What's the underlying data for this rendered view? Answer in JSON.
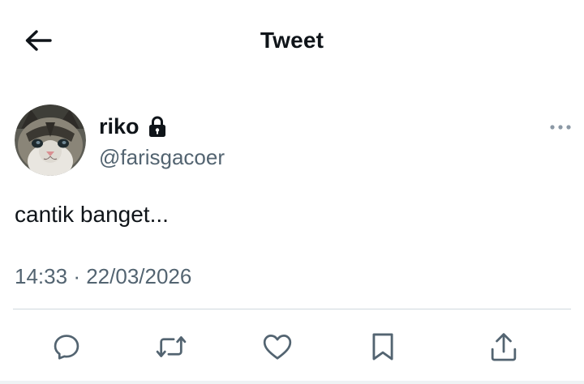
{
  "header": {
    "title": "Tweet",
    "back_icon": "arrow-left-icon"
  },
  "tweet": {
    "author": {
      "display_name": "riko",
      "handle": "@farisgacoer",
      "protected_icon": "lock-icon",
      "avatar": "cat-avatar"
    },
    "text": "cantik banget...",
    "time": "14:33",
    "separator": "·",
    "date": "22/03/2026",
    "more_icon": "more-dots-icon"
  },
  "actions": [
    {
      "name": "reply",
      "icon": "reply-icon"
    },
    {
      "name": "retweet",
      "icon": "retweet-icon"
    },
    {
      "name": "like",
      "icon": "heart-icon"
    },
    {
      "name": "bookmark",
      "icon": "bookmark-icon"
    },
    {
      "name": "share",
      "icon": "share-icon"
    }
  ],
  "colors": {
    "text_primary": "#0f1419",
    "text_secondary": "#536471",
    "divider": "#cfd9de"
  }
}
